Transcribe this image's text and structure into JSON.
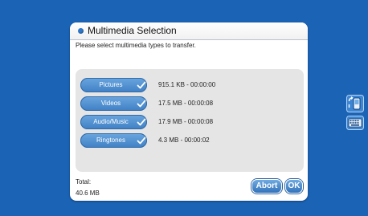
{
  "dialog": {
    "title": "Multimedia Selection",
    "instruction": "Please select multimedia types to transfer.",
    "types": [
      {
        "label": "Pictures",
        "info": "915.1 KB - 00:00:00",
        "selected": true
      },
      {
        "label": "Videos",
        "info": "17.5 MB - 00:00:08",
        "selected": true
      },
      {
        "label": "Audio/Music",
        "info": "17.9 MB - 00:00:08",
        "selected": true
      },
      {
        "label": "Ringtones",
        "info": "4.3 MB - 00:00:02",
        "selected": true
      }
    ],
    "total_label": "Total:",
    "total_value": "40.6 MB",
    "abort_label": "Abort",
    "ok_label": "OK"
  },
  "side_icons": [
    "phone-transfer-icon",
    "keyboard-icon"
  ],
  "colors": {
    "background": "#1b63b5",
    "button": "#3f7fc4",
    "panel": "#e5e5e6"
  }
}
